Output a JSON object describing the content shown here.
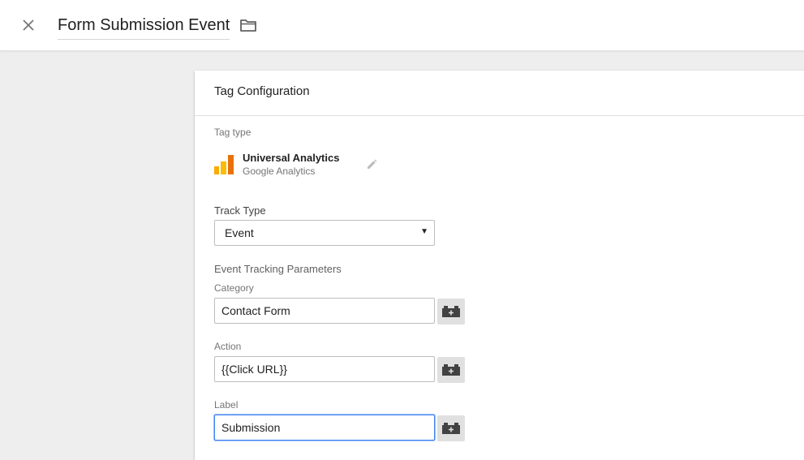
{
  "header": {
    "title": "Form Submission Event",
    "close_icon": "close-icon",
    "folder_icon": "folder-icon"
  },
  "card": {
    "title": "Tag Configuration",
    "tag_type_label": "Tag type",
    "tag_type": {
      "name": "Universal Analytics",
      "provider": "Google Analytics",
      "icon": "google-analytics-logo-icon",
      "edit_icon": "pencil-icon"
    },
    "track_type": {
      "label": "Track Type",
      "selected": "Event",
      "arrow": "▼"
    },
    "event_params_heading": "Event Tracking Parameters",
    "fields": [
      {
        "label": "Category",
        "value": "Contact Form"
      },
      {
        "label": "Action",
        "value": "{{Click URL}}"
      },
      {
        "label": "Label",
        "value": "Submission"
      }
    ],
    "variable_button_icon": "variable-picker-icon"
  },
  "colors": {
    "page_background": "#eeeeee",
    "focus_blue": "#4285f4",
    "ga_orange_dark": "#e8710a",
    "ga_orange": "#f9ab00"
  }
}
